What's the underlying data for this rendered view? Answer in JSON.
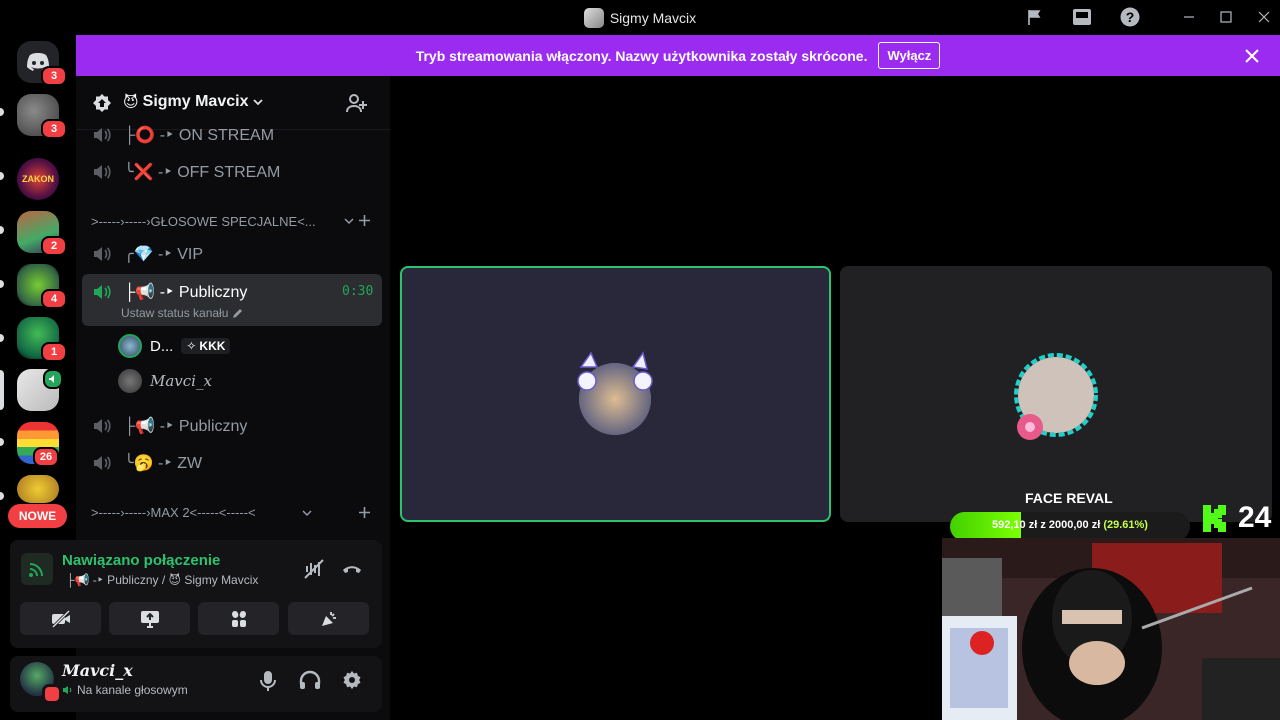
{
  "window": {
    "title": "Sigmy Mavcix"
  },
  "banner": {
    "text": "Tryb streamowania włączony. Nazwy użytkownika zostały skrócone.",
    "button_label": "Wyłącz"
  },
  "rail": {
    "badges": [
      "3",
      "3",
      "2",
      "4",
      "1",
      "26"
    ],
    "new_label": "NOWE"
  },
  "server": {
    "name": "Sigmy Mavcix"
  },
  "channels": {
    "on_stream": "├⭕ -‣ ON STREAM",
    "off_stream": "╰❌ -‣ OFF STREAM",
    "category1": ">-----›-----›GŁOSOWE SPECJALNE<...",
    "vip": "╭💎 -‣ VIP",
    "publiczny_active": "├📢 -‣ Publiczny",
    "timer": "0:30",
    "status_hint": "Ustaw status kanału",
    "member1_name": "D...",
    "member1_tag": "KKK",
    "member2_name": "Mavci_x",
    "publiczny2": "├📢 -‣ Publiczny",
    "zw": "╰🥱 -‣ ZW",
    "category2": ">-----›-----›MAX 2<-----<-----<"
  },
  "voice": {
    "status": "Nawiązano połączenie",
    "location": "├📢 -‣ Publiczny / 😈 Sigmy Mavcix"
  },
  "user": {
    "name": "Mavci_x",
    "status": "Na kanale głosowym"
  },
  "stream": {
    "overlay_title": "FACE REVAL",
    "progress_text": "592,10 zł z 2000,00 zł",
    "progress_percent_text": "(29.61%)",
    "progress_fraction": 0.2961,
    "viewer_count": "24"
  },
  "colors": {
    "accent": "#9b2bf1",
    "connected": "#2dc26e",
    "badge": "#f23f43"
  }
}
